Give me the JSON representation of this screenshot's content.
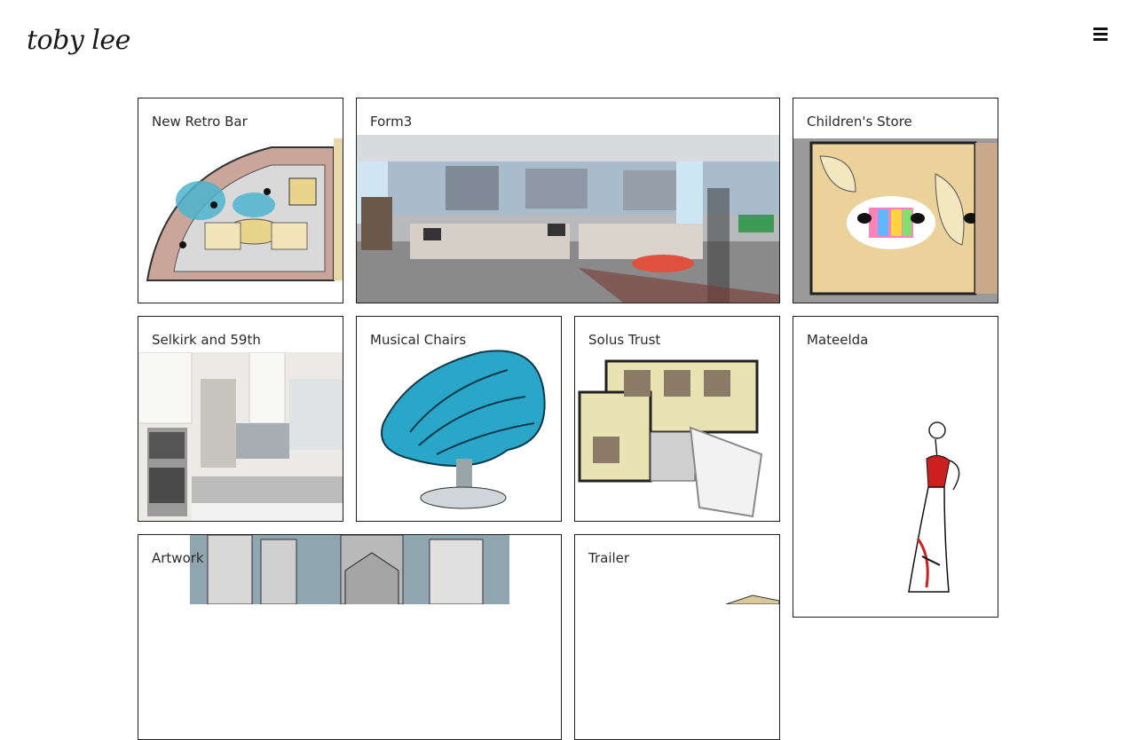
{
  "header": {
    "logo_text": "toby lee",
    "menu_icon": "hamburger-menu-icon"
  },
  "projects": [
    {
      "title": "New Retro Bar"
    },
    {
      "title": "Form3"
    },
    {
      "title": "Children's Store"
    },
    {
      "title": "Selkirk and 59th"
    },
    {
      "title": "Musical Chairs"
    },
    {
      "title": "Solus Trust"
    },
    {
      "title": "Mateelda"
    },
    {
      "title": "Artwork"
    },
    {
      "title": "Trailer"
    }
  ],
  "colors": {
    "border": "#1f1f1f",
    "accent_blue": "#2aa6c9",
    "floorplan_tan": "#e8d7a8",
    "dress_red": "#cc1f1f"
  }
}
